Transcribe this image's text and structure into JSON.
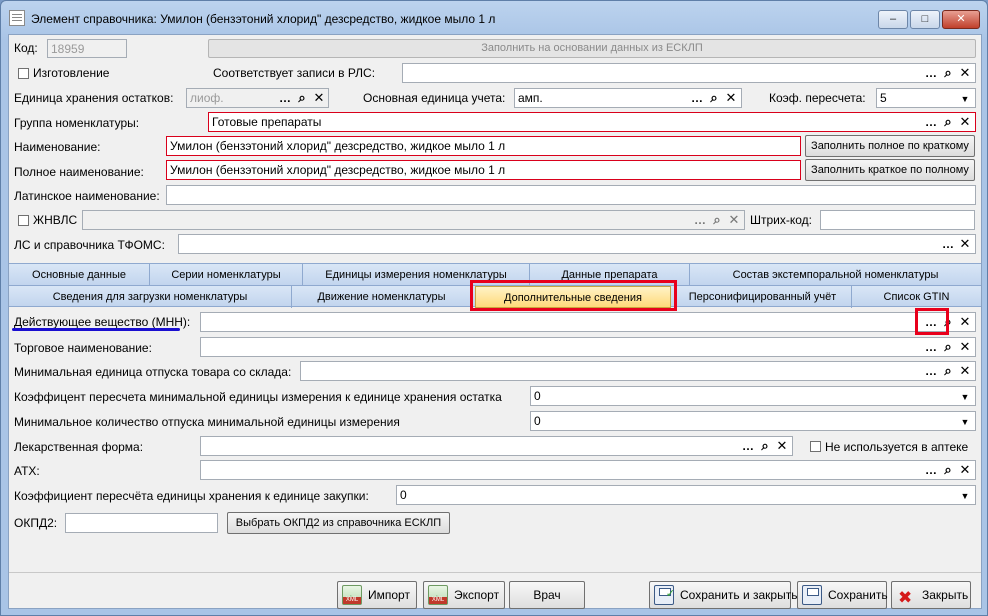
{
  "window": {
    "title": "Элемент справочника: Умилон (бензэтоний хлорид\" дезсредство, жидкое мыло 1 л",
    "minimize_glyph": "–",
    "maximize_glyph": "□",
    "close_glyph": "✕"
  },
  "header": {
    "code_label": "Код:",
    "code_value": "18959",
    "fill_esklp_button": "Заполнить на основании данных из ЕСКЛП",
    "manufacture_label": "Изготовление",
    "rls_label": "Соответствует записи в РЛС:",
    "rls_value": "",
    "storage_unit_label": "Единица хранения остатков:",
    "storage_unit_value": "лиоф.",
    "main_unit_label": "Основная единица учета:",
    "main_unit_value": "амп.",
    "coef_label": "Коэф. пересчета:",
    "coef_value": "5",
    "group_label": "Группа номенклатуры:",
    "group_value": "Готовые препараты",
    "name_label": "Наименование:",
    "name_value": "Умилон (бензэтоний хлорид\" дезсредство, жидкое мыло 1 л",
    "fill_full_button": "Заполнить полное по краткому",
    "full_name_label": "Полное наименование:",
    "full_name_value": "Умилон (бензэтоний хлорид\" дезсредство, жидкое мыло 1 л",
    "fill_short_button": "Заполнить краткое по полному",
    "latin_label": "Латинское наименование:",
    "latin_value": "",
    "zhnvls_label": "ЖНВЛС",
    "barcode_label": "Штрих-код:",
    "barcode_value": "",
    "tfoms_label": "ЛС и справочника ТФОМС:",
    "tfoms_value": ""
  },
  "tabs_row1": [
    {
      "label": "Основные данные"
    },
    {
      "label": "Серии номенклатуры"
    },
    {
      "label": "Единицы измерения номенклатуры"
    },
    {
      "label": "Данные препарата"
    },
    {
      "label": "Состав экстемпоральной номенклатуры"
    }
  ],
  "tabs_row2": [
    {
      "label": "Сведения для загрузки номенклатуры"
    },
    {
      "label": "Движение номенклатуры"
    },
    {
      "label": "Дополнительные сведения"
    },
    {
      "label": "Персонифицированный учёт"
    },
    {
      "label": "Список GTIN"
    }
  ],
  "details": {
    "mnn_label": "Действующее вещество (МНН):",
    "mnn_value": "",
    "trade_name_label": "Торговое наименование:",
    "trade_name_value": "",
    "min_unit_label": "Минимальная единица отпуска товара со склада:",
    "min_unit_value": "",
    "conv_coef_label": "Коэффицент пересчета минимальной единицы измерения к единице хранения остатка",
    "conv_coef_value": "0",
    "min_qty_label": "Минимальное количество отпуска минимальной единицы измерения",
    "min_qty_value": "0",
    "dosage_form_label": "Лекарственная форма:",
    "dosage_form_value": "",
    "not_used_label": "Не используется в аптеке",
    "atc_label": "АТХ:",
    "atc_value": "",
    "purchase_coef_label": "Коэффициент пересчёта единицы хранения к единице закупки:",
    "purchase_coef_value": "0",
    "okpd2_label": "ОКПД2:",
    "okpd2_value": "",
    "okpd2_button": "Выбрать ОКПД2 из справочника ЕСКЛП"
  },
  "bottom": {
    "import_label": "Импорт",
    "export_label": "Экспорт",
    "doctor_label": "Врач",
    "save_close_label": "Сохранить и закрыть",
    "save_label": "Сохранить",
    "close_label": "Закрыть"
  },
  "colors": {
    "highlight": "#e8001c",
    "underline": "#1a0fd0",
    "active_tab": "#ffd97a",
    "required_border": "#d9001b"
  }
}
